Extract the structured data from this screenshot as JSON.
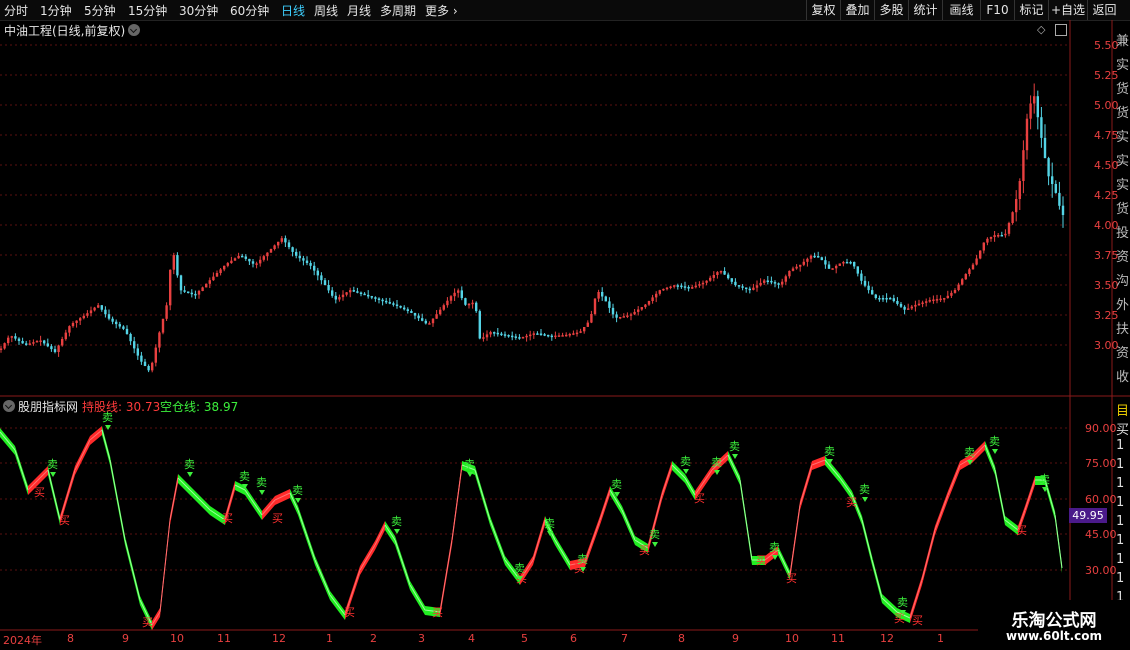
{
  "toolbar": {
    "periods": [
      "分时",
      "1分钟",
      "5分钟",
      "15分钟",
      "30分钟",
      "60分钟",
      "日线",
      "周线",
      "月线",
      "多周期",
      "更多"
    ],
    "active_period": "日线",
    "right_buttons": [
      "复权",
      "叠加",
      "多股",
      "统计",
      "画线",
      "F10",
      "标记",
      "+自选",
      "返回"
    ]
  },
  "main_chart": {
    "title": "中油工程(日线,前复权)",
    "y_ticks": [
      "5.50",
      "5.25",
      "5.00",
      "4.75",
      "4.50",
      "4.25",
      "4.00",
      "3.75",
      "3.50",
      "3.25",
      "3.00"
    ],
    "up_color": "#e84040",
    "down_color": "#54d4e6"
  },
  "indicator": {
    "name": "股朋指标网",
    "hold_label": "持股线: 30.73",
    "empty_label": "空仓线: 38.97",
    "y_ticks": [
      "90.00",
      "75.00",
      "60.00",
      "45.00",
      "30.00"
    ],
    "current_value": "49.95",
    "buy_mark": "买",
    "sell_mark": "卖"
  },
  "x_axis": [
    "2024年",
    "8",
    "9",
    "10",
    "11",
    "12",
    "1",
    "2",
    "3",
    "4",
    "5",
    "6",
    "7",
    "8",
    "9",
    "10",
    "11",
    "12",
    "1"
  ],
  "right_panel": {
    "glyphs": [
      "兼",
      "实",
      "货",
      "货",
      "实",
      "实",
      "实",
      "货",
      "投",
      "资",
      "沟",
      "外",
      "扶",
      "资",
      "收"
    ],
    "lower_glyphs": [
      "目",
      "买",
      "1",
      "1",
      "1",
      "1",
      "1",
      "1",
      "1",
      "1",
      "1"
    ]
  },
  "watermark": {
    "title": "乐淘公式网",
    "url": "www.60lt.com"
  }
}
